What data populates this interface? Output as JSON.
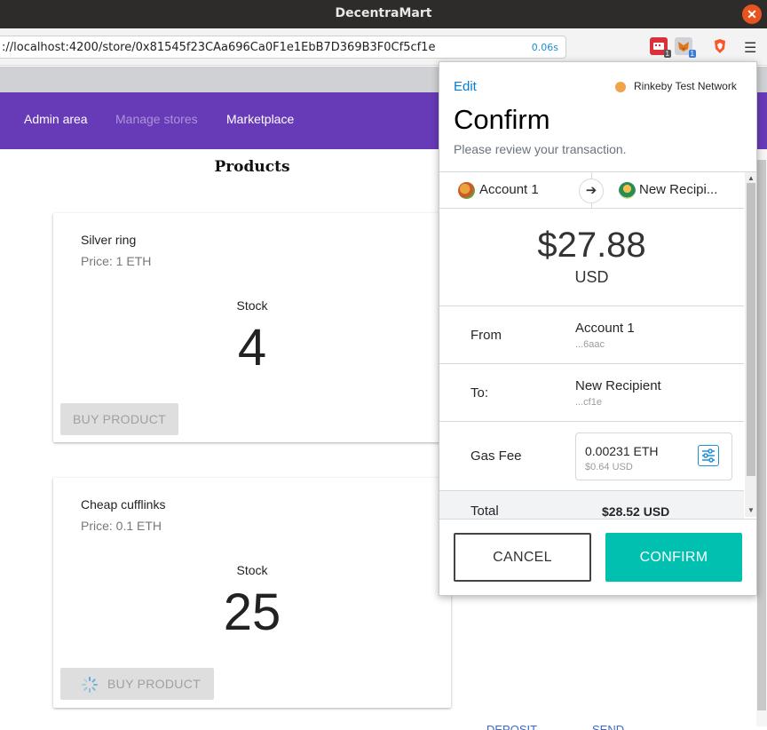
{
  "window": {
    "title": "DecentraMart"
  },
  "browser": {
    "url": "://localhost:4200/store/0x81545f23CAa696Ca0F1e1EbB7D369B3F0Cf5cf1e",
    "load_time": "0.06s",
    "ext_badge_1": "1",
    "ext_badge_2": "1"
  },
  "nav": {
    "admin": "Admin area",
    "manage": "Manage stores",
    "marketplace": "Marketplace"
  },
  "page": {
    "heading": "Products",
    "products": [
      {
        "name": "Silver ring",
        "price": "Price: 1 ETH",
        "stock_label": "Stock",
        "stock": "4",
        "button": "BUY PRODUCT"
      },
      {
        "name": "Cheap cufflinks",
        "price": "Price: 0.1 ETH",
        "stock_label": "Stock",
        "stock": "25",
        "button": "BUY PRODUCT"
      }
    ],
    "bottom_links": [
      "DEPOSIT",
      "SEND"
    ]
  },
  "metamask": {
    "edit": "Edit",
    "network": "Rinkeby Test Network",
    "title": "Confirm",
    "subtitle": "Please review your transaction.",
    "from_account": "Account 1",
    "to_account": "New Recipi...",
    "amount": "$27.88",
    "amount_currency": "USD",
    "from_label": "From",
    "from_name": "Account 1",
    "from_addr": "...6aac",
    "to_label": "To:",
    "to_name": "New Recipient",
    "to_addr": "...cf1e",
    "gas_label": "Gas Fee",
    "gas_value": "0.00231  ETH",
    "gas_usd": "$0.64 USD",
    "total_label": "Total",
    "total_value": "$28.52 USD",
    "cancel": "CANCEL",
    "confirm": "CONFIRM"
  },
  "colors": {
    "nav_bg": "#673ab7",
    "confirm_bg": "#00c1b0",
    "link": "#037dd6",
    "network_dot": "#f0a44a"
  }
}
